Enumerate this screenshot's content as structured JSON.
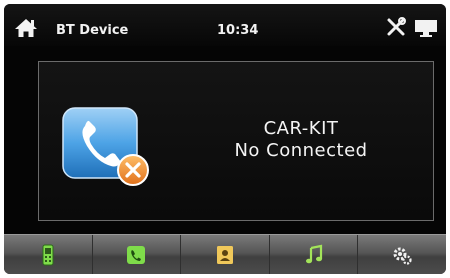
{
  "statusbar": {
    "title": "BT Device",
    "time": "10:34",
    "icons": [
      "home-icon",
      "tools-icon",
      "display-icon"
    ]
  },
  "connection": {
    "device_name": "CAR-KIT",
    "status": "No Connected",
    "icon": "phone-disconnected-icon"
  },
  "navbar": {
    "items": [
      {
        "name": "mobile-phone-icon",
        "color": "#7fdc4a"
      },
      {
        "name": "dialer-icon",
        "color": "#7fdc4a"
      },
      {
        "name": "contacts-icon",
        "color": "#f0c85a"
      },
      {
        "name": "music-icon",
        "color": "#a3e45a"
      },
      {
        "name": "settings-icon",
        "color": "#f2f2f2"
      }
    ]
  },
  "colors": {
    "background": "#050505",
    "text": "#f4f4f4",
    "panel_border": "#6b6b6b",
    "icon_blue": "#4da3e6",
    "badge_orange": "#f0902a"
  }
}
